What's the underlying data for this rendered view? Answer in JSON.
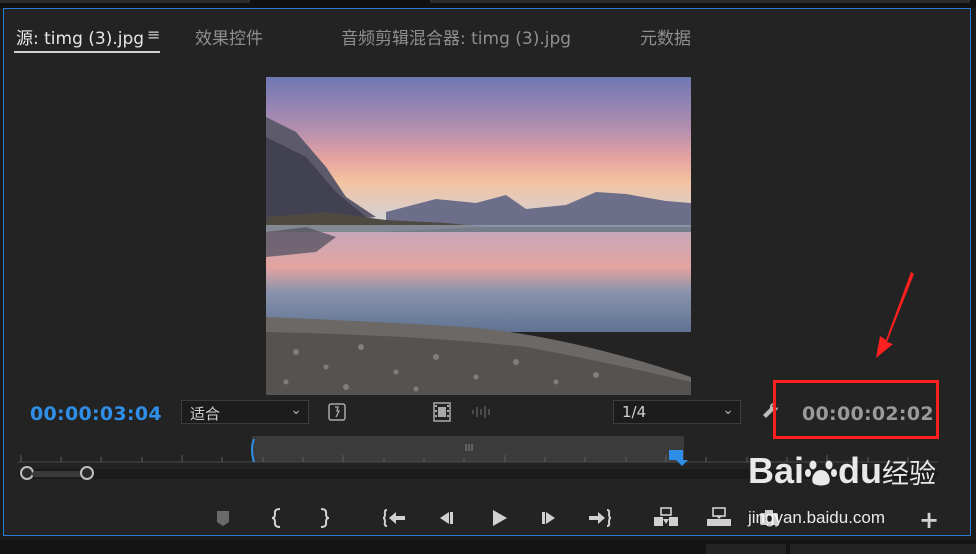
{
  "tabs": [
    {
      "label": "源: timg (3).jpg",
      "active": true
    },
    {
      "label": "效果控件",
      "active": false
    },
    {
      "label": "音频剪辑混合器: timg (3).jpg",
      "active": false
    },
    {
      "label": "元数据",
      "active": false
    }
  ],
  "tab_menu_icon": "hamburger-menu-icon",
  "timecode_current": "00:00:03:04",
  "timecode_duration": "00:00:02:02",
  "zoom_select": {
    "value": "适合"
  },
  "resolution_select": {
    "value": "1/4"
  },
  "colors": {
    "accent": "#2f8fe8",
    "panel_bg": "#232323",
    "focus_border": "#2f7bd1",
    "annotation": "#ff1f1f"
  },
  "controls": [
    "add-marker-icon",
    "mark-in-icon",
    "mark-out-icon",
    "go-to-in-icon",
    "step-back-icon",
    "play-icon",
    "step-forward-icon",
    "go-to-out-icon",
    "insert-icon",
    "overwrite-icon",
    "export-frame-icon",
    "add-button-icon"
  ],
  "watermark": {
    "brand": "Bai",
    "brand2": "du",
    "cn": "经验",
    "url": "jingyan.baidu.com"
  }
}
